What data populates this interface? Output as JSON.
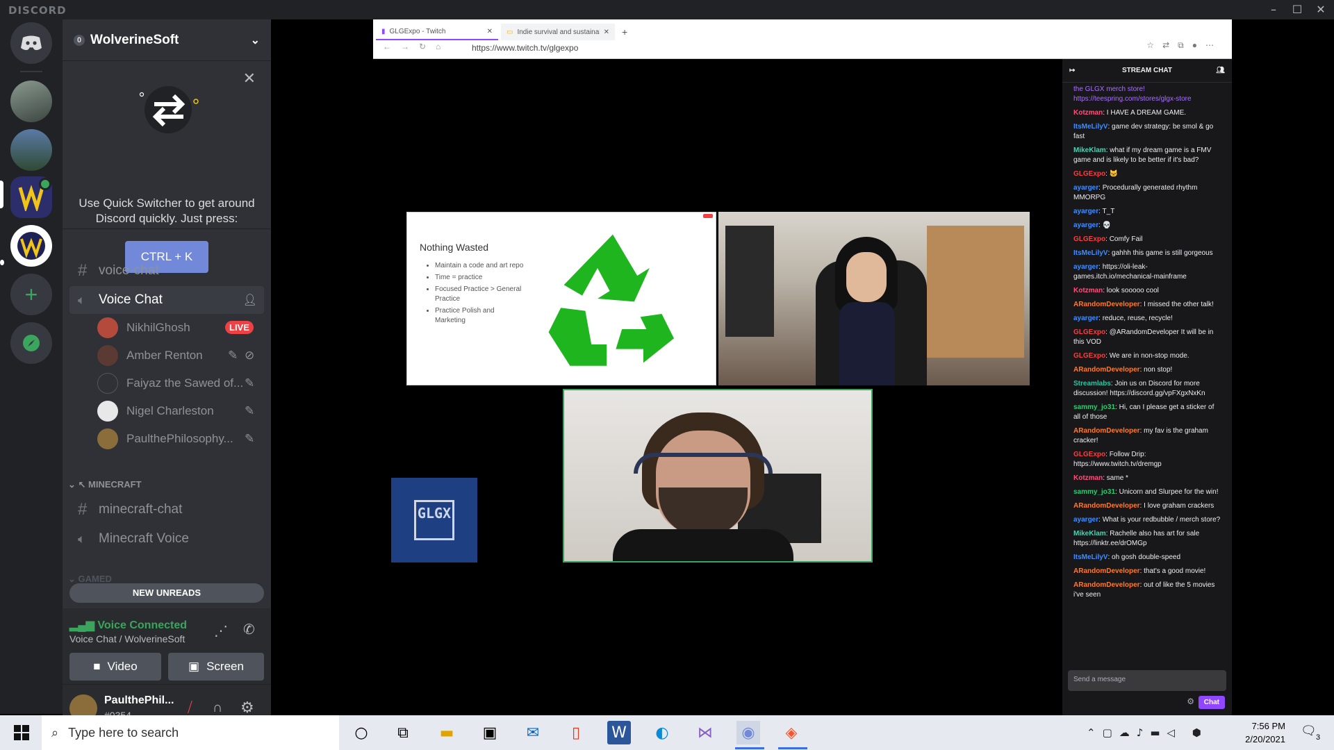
{
  "app": {
    "brand": "DISCORD"
  },
  "server": {
    "name": "WolverineSoft"
  },
  "quick_switcher": {
    "text": "Use Quick Switcher to get around Discord quickly. Just press:",
    "button": "CTRL + K"
  },
  "channels": {
    "voice_chat_text": "voice-chat",
    "voice_chat": "Voice Chat",
    "users": [
      {
        "name": "NikhilGhosh",
        "badge": "LIVE"
      },
      {
        "name": "Amber Renton"
      },
      {
        "name": "Faiyaz the Sawed of..."
      },
      {
        "name": "Nigel Charleston"
      },
      {
        "name": "PaulthePhilosophy..."
      }
    ],
    "category": "MINECRAFT",
    "mc_chat": "minecraft-chat",
    "mc_voice": "Minecraft Voice",
    "hidden_category": "GAMED",
    "new_unreads": "NEW UNREADS"
  },
  "voice": {
    "status": "Voice Connected",
    "location": "Voice Chat / WolverineSoft",
    "video": "Video",
    "screen": "Screen"
  },
  "user": {
    "name": "PaulthePhil...",
    "tag": "#0354"
  },
  "browser": {
    "tabs": [
      "GLGExpo - Twitch",
      "Indie survival and sustainability"
    ],
    "url": "https://www.twitch.tv/glgexpo"
  },
  "slide": {
    "title": "Nothing Wasted",
    "bullets": [
      "Maintain a code and art repo",
      "Time = practice",
      "Focused Practice > General Practice",
      "Practice Polish and Marketing"
    ]
  },
  "logo_text": "GLGX",
  "stream_chat": {
    "header": "STREAM CHAT",
    "placeholder": "Send a message",
    "send": "Chat",
    "messages": [
      {
        "name": "",
        "color": "#a970ff",
        "text": "the GLGX merch store! https://teespring.com/stores/glgx-store"
      },
      {
        "name": "Kotzman",
        "color": "#ff4f7b",
        "text": "I HAVE A DREAM GAME."
      },
      {
        "name": "ItsMeLilyV",
        "color": "#3e8eff",
        "text": "game dev strategy: be smol & go fast"
      },
      {
        "name": "MikeKlam",
        "color": "#4fd1b1",
        "text": "what if my dream game is a FMV game and is likely to be better if it's bad?"
      },
      {
        "name": "GLGExpo",
        "color": "#ff3b3b",
        "text": "🐱"
      },
      {
        "name": "ayarger",
        "color": "#3e8eff",
        "text": "Procedurally generated rhythm MMORPG"
      },
      {
        "name": "ayarger",
        "color": "#3e8eff",
        "text": "T_T"
      },
      {
        "name": "ayarger",
        "color": "#3e8eff",
        "text": "💀"
      },
      {
        "name": "GLGExpo",
        "color": "#ff3b3b",
        "text": "Comfy Fail"
      },
      {
        "name": "ItsMeLilyV",
        "color": "#3e8eff",
        "text": "gahhh this game is still gorgeous"
      },
      {
        "name": "ayarger",
        "color": "#3e8eff",
        "text": "https://oli-leak-games.itch.io/mechanical-mainframe"
      },
      {
        "name": "Kotzman",
        "color": "#ff4f7b",
        "text": "look sooooo cool"
      },
      {
        "name": "ARandomDeveloper",
        "color": "#ff7a29",
        "text": "I missed the other talk!"
      },
      {
        "name": "ayarger",
        "color": "#3e8eff",
        "text": "reduce, reuse, recycle!"
      },
      {
        "name": "GLGExpo",
        "color": "#ff3b3b",
        "text": "@ARandomDeveloper It will be in this VOD"
      },
      {
        "name": "GLGExpo",
        "color": "#ff3b3b",
        "text": "We are in non-stop mode."
      },
      {
        "name": "ARandomDeveloper",
        "color": "#ff7a29",
        "text": "non stop!"
      },
      {
        "name": "Streamlabs",
        "color": "#31c3a2",
        "text": "Join us on Discord for more discussion! https://discord.gg/vpFXgxNxKn"
      },
      {
        "name": "sammy_jo31",
        "color": "#2ecc71",
        "text": "Hi, can I please get a sticker of all of those"
      },
      {
        "name": "ARandomDeveloper",
        "color": "#ff7a29",
        "text": "my fav is the graham cracker!"
      },
      {
        "name": "GLGExpo",
        "color": "#ff3b3b",
        "text": "Follow Drip: https://www.twitch.tv/dremgp"
      },
      {
        "name": "Kotzman",
        "color": "#ff4f7b",
        "text": "same *"
      },
      {
        "name": "sammy_jo31",
        "color": "#2ecc71",
        "text": "Unicorn and Slurpee for the win!"
      },
      {
        "name": "ARandomDeveloper",
        "color": "#ff7a29",
        "text": "I love graham crackers"
      },
      {
        "name": "ayarger",
        "color": "#3e8eff",
        "text": "What is your redbubble / merch store?"
      },
      {
        "name": "MikeKlam",
        "color": "#4fd1b1",
        "text": "Rachelle also has art for sale https://linktr.ee/drOMGp"
      },
      {
        "name": "ItsMeLilyV",
        "color": "#3e8eff",
        "text": "oh gosh double-speed"
      },
      {
        "name": "ARandomDeveloper",
        "color": "#ff7a29",
        "text": "that's a good movie!"
      },
      {
        "name": "ARandomDeveloper",
        "color": "#ff7a29",
        "text": "out of like the 5 movies i've seen"
      }
    ]
  },
  "taskbar": {
    "search": "Type here to search",
    "time": "7:56 PM",
    "date": "2/20/2021",
    "notifications": "3"
  },
  "colors": {
    "blurple": "#7289da",
    "green": "#3ba55d",
    "live": "#ed4245",
    "twitch": "#9147ff"
  }
}
